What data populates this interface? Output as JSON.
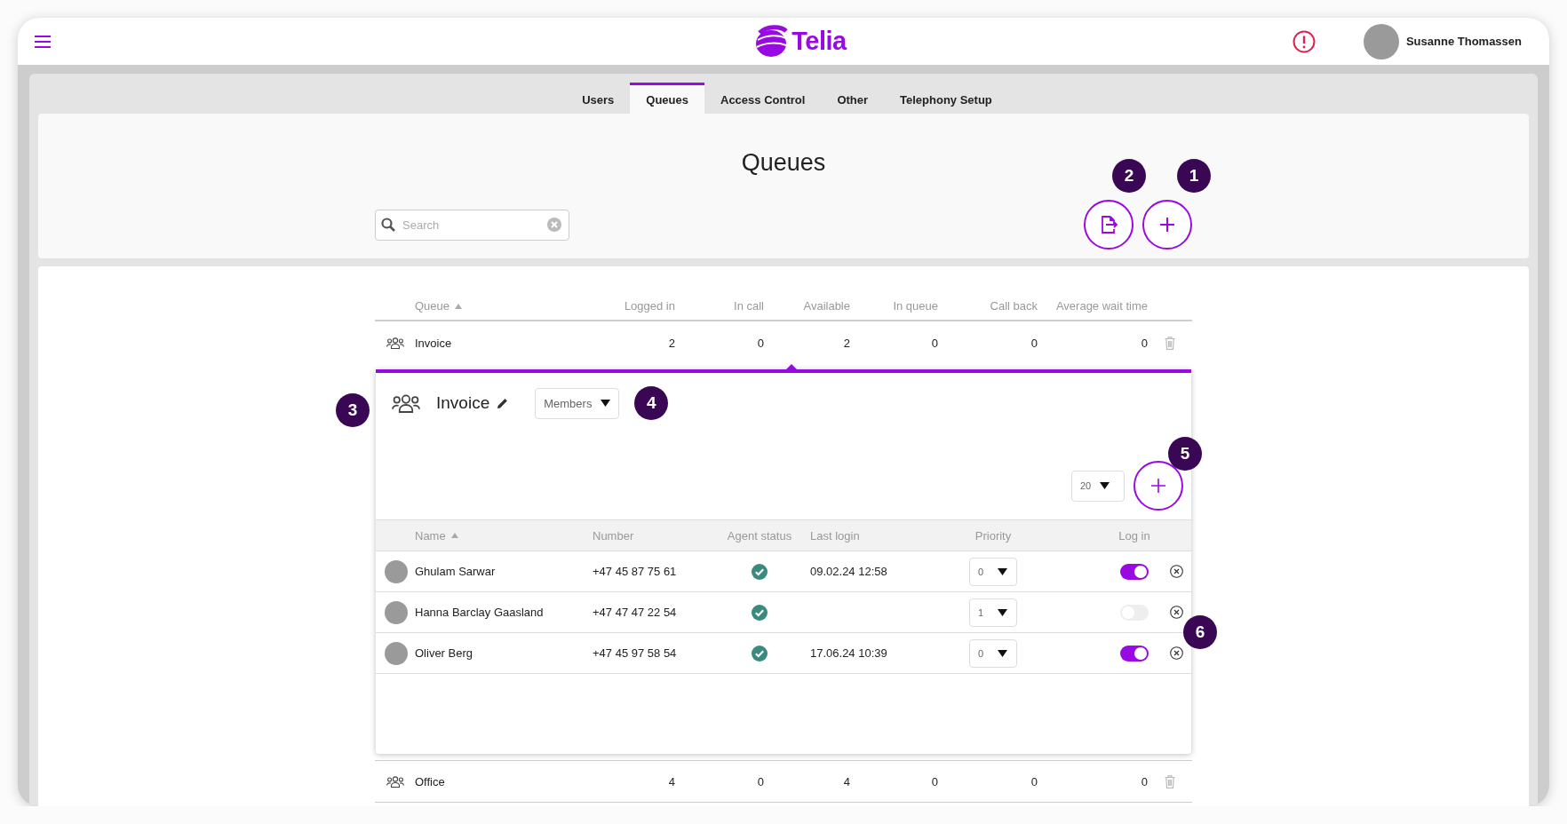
{
  "header": {
    "brand": "Telia",
    "user": {
      "name": "Susanne Thomassen"
    }
  },
  "tabs": [
    {
      "label": "Users",
      "selected": false
    },
    {
      "label": "Queues",
      "selected": true
    },
    {
      "label": "Access Control",
      "selected": false
    },
    {
      "label": "Other",
      "selected": false
    },
    {
      "label": "Telephony Setup",
      "selected": false
    }
  ],
  "page_title": "Queues",
  "search": {
    "placeholder": "Search"
  },
  "toolbar": [
    {
      "kind": "export",
      "annotation": "2"
    },
    {
      "kind": "add",
      "annotation": "1"
    }
  ],
  "queues": {
    "columns": [
      {
        "label": "Queue",
        "sorted": true
      },
      {
        "label": "Logged in",
        "sorted": false
      },
      {
        "label": "In call",
        "sorted": false
      },
      {
        "label": "Available",
        "sorted": false
      },
      {
        "label": "In queue",
        "sorted": false
      },
      {
        "label": "Call back",
        "sorted": false
      },
      {
        "label": "Average wait time",
        "sorted": false
      }
    ],
    "rows": [
      {
        "name": "Invoice",
        "values": [
          "2",
          "0",
          "2",
          "0",
          "0",
          "0"
        ],
        "expanded": true
      },
      {
        "name": "Office",
        "values": [
          "4",
          "0",
          "4",
          "0",
          "0",
          "0"
        ],
        "expanded": false
      }
    ]
  },
  "queue_detail": {
    "name": "Invoice",
    "icon_annotation": "3",
    "view_select": {
      "value": "Members",
      "annotation": "4"
    },
    "page_size": "20",
    "add_annotation": "5",
    "members": {
      "annotation": "6",
      "columns": [
        {
          "label": "Name",
          "sorted": true
        },
        {
          "label": "Number",
          "sorted": false
        },
        {
          "label": "Agent status",
          "sorted": false
        },
        {
          "label": "Last login",
          "sorted": false
        },
        {
          "label": "Priority",
          "sorted": false
        },
        {
          "label": "Log in",
          "sorted": false
        }
      ],
      "rows": [
        {
          "name": "Ghulam Sarwar",
          "number": "+47 45 87 75 61",
          "agent_available": true,
          "last_login": "09.02.24 12:58",
          "priority": "0",
          "logged_in": true
        },
        {
          "name": "Hanna Barclay Gaasland",
          "number": "+47 47 47 22 54",
          "agent_available": true,
          "priority": "1",
          "logged_in": false
        },
        {
          "name": "Oliver Berg",
          "number": "+47 45 97 58 54",
          "agent_available": true,
          "last_login": "17.06.24 10:39",
          "priority": "0",
          "logged_in": true
        }
      ]
    }
  }
}
